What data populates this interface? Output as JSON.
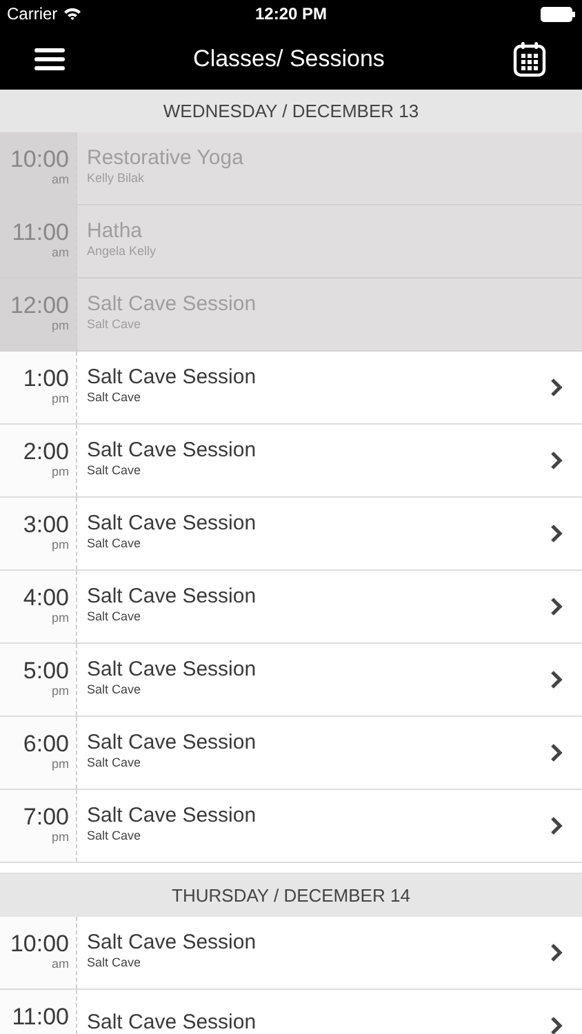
{
  "status_bar": {
    "carrier": "Carrier",
    "time": "12:20 PM"
  },
  "nav_bar": {
    "title": "Classes/ Sessions"
  },
  "sections": [
    {
      "header": "WEDNESDAY / DECEMBER 13",
      "rows": [
        {
          "time": "10:00",
          "period": "am",
          "title": "Restorative Yoga",
          "subtitle": "Kelly Bilak",
          "past": true
        },
        {
          "time": "11:00",
          "period": "am",
          "title": "Hatha",
          "subtitle": "Angela Kelly",
          "past": true
        },
        {
          "time": "12:00",
          "period": "pm",
          "title": "Salt Cave Session",
          "subtitle": "Salt Cave",
          "past": true
        },
        {
          "time": "1:00",
          "period": "pm",
          "title": "Salt Cave Session",
          "subtitle": "Salt Cave",
          "past": false
        },
        {
          "time": "2:00",
          "period": "pm",
          "title": "Salt Cave Session",
          "subtitle": "Salt Cave",
          "past": false
        },
        {
          "time": "3:00",
          "period": "pm",
          "title": "Salt Cave Session",
          "subtitle": "Salt Cave",
          "past": false
        },
        {
          "time": "4:00",
          "period": "pm",
          "title": "Salt Cave Session",
          "subtitle": "Salt Cave",
          "past": false
        },
        {
          "time": "5:00",
          "period": "pm",
          "title": "Salt Cave Session",
          "subtitle": "Salt Cave",
          "past": false
        },
        {
          "time": "6:00",
          "period": "pm",
          "title": "Salt Cave Session",
          "subtitle": "Salt Cave",
          "past": false
        },
        {
          "time": "7:00",
          "period": "pm",
          "title": "Salt Cave Session",
          "subtitle": "Salt Cave",
          "past": false
        }
      ]
    },
    {
      "header": "THURSDAY / DECEMBER 14",
      "rows": [
        {
          "time": "10:00",
          "period": "am",
          "title": "Salt Cave Session",
          "subtitle": "Salt Cave",
          "past": false
        },
        {
          "time": "11:00",
          "title": "Salt Cave Session",
          "past": false
        }
      ]
    }
  ]
}
